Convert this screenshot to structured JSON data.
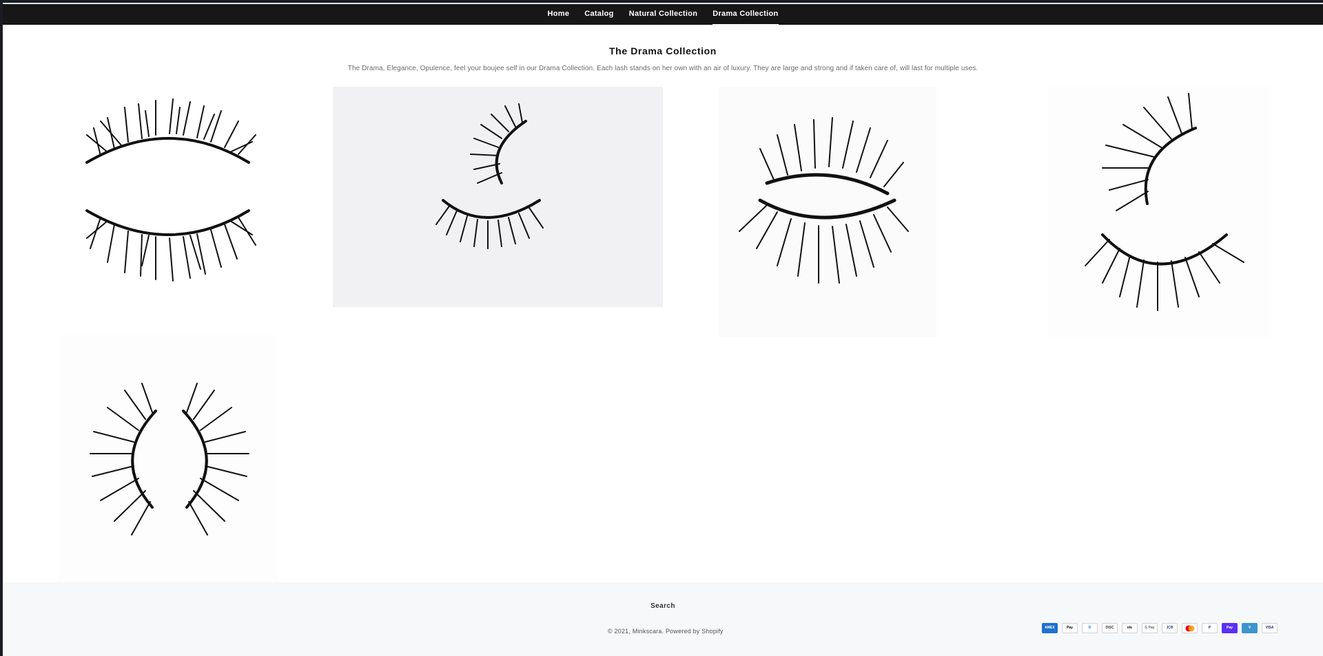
{
  "nav": {
    "items": [
      {
        "label": "Home",
        "active": false
      },
      {
        "label": "Catalog",
        "active": false
      },
      {
        "label": "Natural Collection",
        "active": false
      },
      {
        "label": "Drama Collection",
        "active": true
      }
    ]
  },
  "collection": {
    "title": "The Drama Collection",
    "description": "The Drama, Elegance, Opulence,  feel your boujee self in our Drama Collection. Each lash stands on her own with an air of luxury. They are large and strong and if taken care of, will last for multiple uses."
  },
  "footer": {
    "search_label": "Search",
    "copyright_prefix": "© 2021, ",
    "store_name": "Minkscara",
    "powered_by": ". Powered by Shopify",
    "payment_icons": [
      {
        "name": "american-express-icon",
        "text": "AMEX",
        "bg": "#1f72cd",
        "fg": "#ffffff"
      },
      {
        "name": "apple-pay-icon",
        "text": "Pay",
        "bg": "#ffffff",
        "fg": "#000000"
      },
      {
        "name": "diners-club-icon",
        "text": "D",
        "bg": "#ffffff",
        "fg": "#0079be"
      },
      {
        "name": "discover-icon",
        "text": "DISC",
        "bg": "#ffffff",
        "fg": "#333333"
      },
      {
        "name": "elo-icon",
        "text": "elo",
        "bg": "#ffffff",
        "fg": "#000000"
      },
      {
        "name": "google-pay-icon",
        "text": "G Pay",
        "bg": "#ffffff",
        "fg": "#5f6368"
      },
      {
        "name": "jcb-icon",
        "text": "JCB",
        "bg": "#ffffff",
        "fg": "#0e4c96"
      },
      {
        "name": "mastercard-icon",
        "text": "",
        "bg": "#ffffff",
        "fg": "#eb001b"
      },
      {
        "name": "paypal-icon",
        "text": "P",
        "bg": "#ffffff",
        "fg": "#003087"
      },
      {
        "name": "shop-pay-icon",
        "text": "Pay",
        "bg": "#5a31f4",
        "fg": "#ffffff"
      },
      {
        "name": "venmo-icon",
        "text": "V",
        "bg": "#3d95ce",
        "fg": "#ffffff"
      },
      {
        "name": "visa-icon",
        "text": "VISA",
        "bg": "#ffffff",
        "fg": "#1a1f71"
      }
    ]
  }
}
